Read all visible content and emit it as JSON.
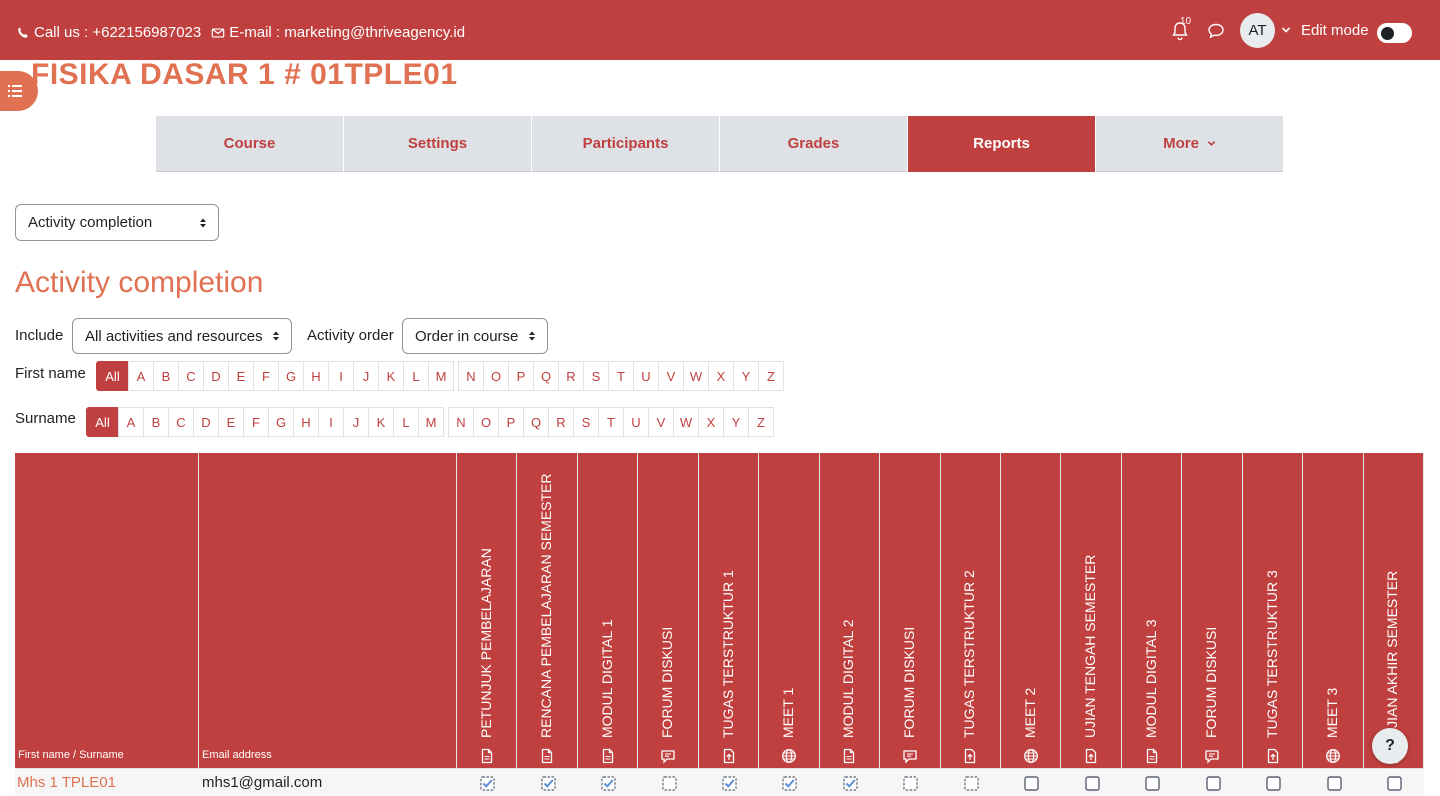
{
  "topbar": {
    "phone": "Call us : +622156987023",
    "email": "E-mail : marketing@thriveagency.id",
    "notification_count": "10",
    "avatar_initials": "AT",
    "edit_mode_label": "Edit mode"
  },
  "course_title": "FISIKA DASAR 1 # 01TPLE01",
  "tabs": [
    {
      "label": "Course"
    },
    {
      "label": "Settings"
    },
    {
      "label": "Participants"
    },
    {
      "label": "Grades"
    },
    {
      "label": "Reports",
      "active": true
    },
    {
      "label": "More"
    }
  ],
  "report_select": "Activity completion",
  "heading": "Activity completion",
  "filters": {
    "include_label": "Include",
    "include_value": "All activities and resources",
    "order_label": "Activity order",
    "order_value": "Order in course",
    "firstname_label": "First name",
    "surname_label": "Surname",
    "all_label": "All",
    "letters": [
      "A",
      "B",
      "C",
      "D",
      "E",
      "F",
      "G",
      "H",
      "I",
      "J",
      "K",
      "L",
      "M",
      "N",
      "O",
      "P",
      "Q",
      "R",
      "S",
      "T",
      "U",
      "V",
      "W",
      "X",
      "Y",
      "Z"
    ]
  },
  "table": {
    "col_name": "First name / Surname",
    "col_email": "Email address",
    "activities": [
      {
        "name": "PETUNJUK PEMBELAJARAN",
        "icon": "file-icon"
      },
      {
        "name": "RENCANA PEMBELAJARAN SEMESTER",
        "icon": "file-icon"
      },
      {
        "name": "MODUL DIGITAL 1",
        "icon": "file-icon"
      },
      {
        "name": "FORUM DISKUSI",
        "icon": "forum-icon"
      },
      {
        "name": "TUGAS TERSTRUKTUR 1",
        "icon": "assign-icon"
      },
      {
        "name": "MEET 1",
        "icon": "globe-icon"
      },
      {
        "name": "MODUL DIGITAL 2",
        "icon": "file-icon"
      },
      {
        "name": "FORUM DISKUSI",
        "icon": "forum-icon"
      },
      {
        "name": "TUGAS TERSTRUKTUR 2",
        "icon": "assign-icon"
      },
      {
        "name": "MEET 2",
        "icon": "globe-icon"
      },
      {
        "name": "UJIAN TENGAH SEMESTER",
        "icon": "assign-icon"
      },
      {
        "name": "MODUL DIGITAL 3",
        "icon": "file-icon"
      },
      {
        "name": "FORUM DISKUSI",
        "icon": "forum-icon"
      },
      {
        "name": "TUGAS TERSTRUKTUR 3",
        "icon": "assign-icon"
      },
      {
        "name": "MEET 3",
        "icon": "globe-icon"
      },
      {
        "name": "UJIAN AKHIR SEMESTER",
        "icon": "assign-icon"
      }
    ],
    "rows": [
      {
        "name": "Mhs 1 TPLE01",
        "email": "mhs1@gmail.com",
        "status": [
          "auto-done",
          "auto-done",
          "auto-done",
          "auto-empty",
          "auto-done",
          "auto-done",
          "auto-done",
          "auto-empty",
          "auto-empty",
          "manual",
          "manual",
          "manual",
          "manual",
          "manual",
          "manual",
          "manual"
        ]
      }
    ]
  },
  "help_label": "?",
  "colors": {
    "brand": "#c0403f",
    "accent": "#e07152",
    "check": "#5b8ed8"
  }
}
